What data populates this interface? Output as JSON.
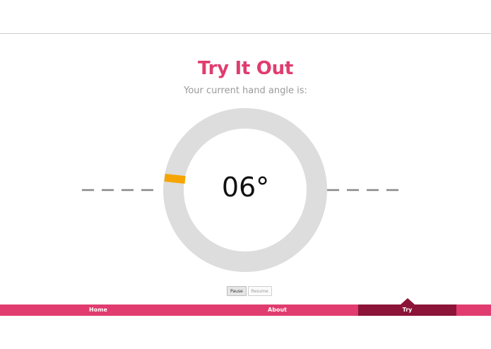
{
  "header": {
    "title": "Try It Out",
    "subtitle": "Your current hand angle is:"
  },
  "gauge": {
    "angle_display": "06°",
    "angle_degrees": 6,
    "track_color": "#dddddd",
    "indicator_color": "#f5a400",
    "dash_color": "#888888"
  },
  "controls": {
    "pause_label": "Pause",
    "resume_label": "Resume"
  },
  "nav": {
    "home_label": "Home",
    "about_label": "About",
    "try_label": "Try",
    "active": "Try"
  },
  "colors": {
    "accent": "#e03c6f",
    "accent_dark": "#8c1438"
  }
}
